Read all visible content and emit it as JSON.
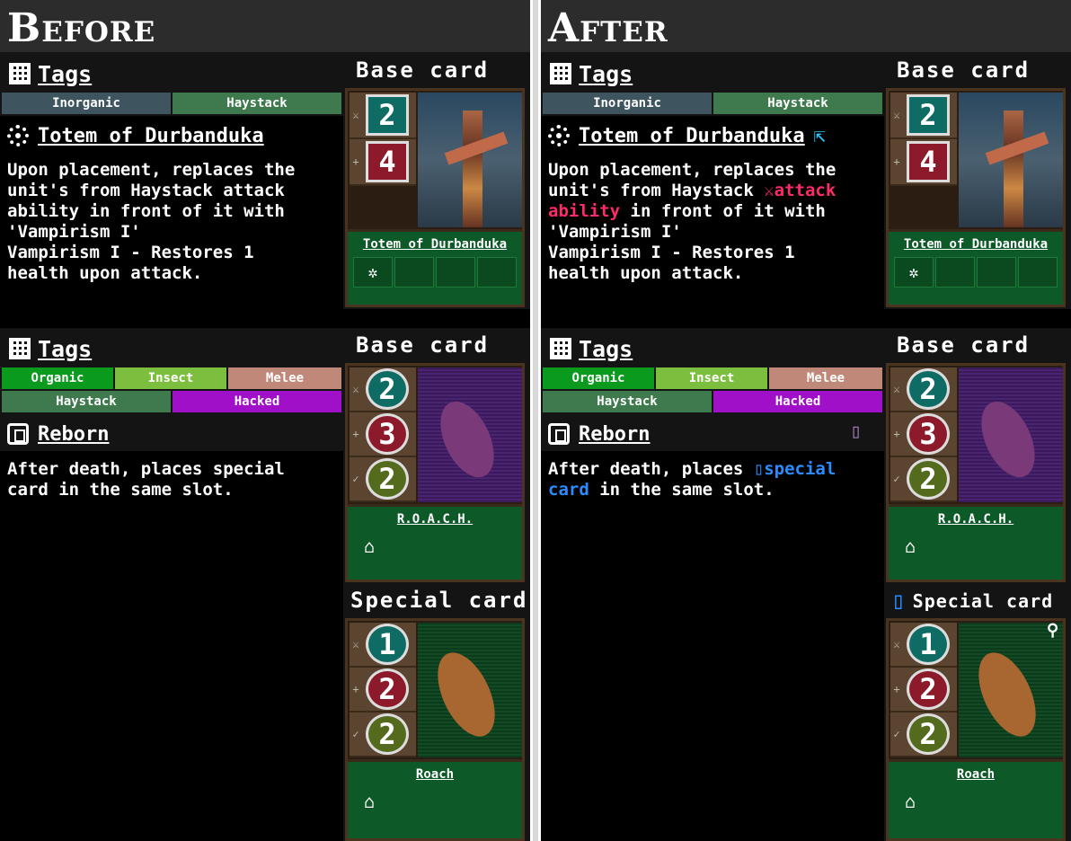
{
  "before": {
    "title": "Before",
    "panel1": {
      "tags_label": "Tags",
      "base_card_label": "Base card",
      "tags": [
        "Inorganic",
        "Haystack"
      ],
      "ability_name": "Totem of Durbanduka",
      "description": [
        "Upon placement, replaces the",
        "unit's from Haystack attack",
        "ability in front of it with",
        "'Vampirism I'",
        "Vampirism I - Restores 1",
        "health upon attack."
      ],
      "card": {
        "attack": "2",
        "health": "4",
        "name": "Totem of Durbanduka"
      }
    },
    "panel2": {
      "tags_label": "Tags",
      "base_card_label": "Base card",
      "tags_row1": [
        "Organic",
        "Insect",
        "Melee"
      ],
      "tags_row2": [
        "Haystack",
        "Hacked"
      ],
      "ability_name": "Reborn",
      "description": [
        "After death, places special",
        "card in the same slot."
      ],
      "card": {
        "attack": "2",
        "health": "3",
        "armor": "2",
        "name": "R.O.A.C.H."
      },
      "special_card_label": "Special card",
      "special_card": {
        "attack": "1",
        "health": "2",
        "armor": "2",
        "name": "Roach"
      }
    }
  },
  "after": {
    "title": "After",
    "panel1": {
      "tags_label": "Tags",
      "base_card_label": "Base card",
      "tags": [
        "Inorganic",
        "Haystack"
      ],
      "ability_name": "Totem of Durbanduka",
      "description": {
        "l1": "Upon placement, replaces the",
        "l2a": "unit's from Haystack ",
        "l2b": "attack",
        "l3a": "ability",
        "l3b": " in front of it with",
        "l4": "'Vampirism I'",
        "l5": "Vampirism I - Restores 1",
        "l6": "health upon attack."
      },
      "card": {
        "attack": "2",
        "health": "4",
        "name": "Totem of Durbanduka"
      }
    },
    "panel2": {
      "tags_label": "Tags",
      "base_card_label": "Base card",
      "tags_row1": [
        "Organic",
        "Insect",
        "Melee"
      ],
      "tags_row2": [
        "Haystack",
        "Hacked"
      ],
      "ability_name": "Reborn",
      "description": {
        "l1a": "After death, places ",
        "l1b": "special",
        "l2a": "card",
        "l2b": " in the same slot."
      },
      "card": {
        "attack": "2",
        "health": "3",
        "armor": "2",
        "name": "R.O.A.C.H."
      },
      "special_card_label": "Special card",
      "special_card": {
        "attack": "1",
        "health": "2",
        "armor": "2",
        "name": "Roach"
      }
    }
  },
  "colors": {
    "inorganic": "#3e545e",
    "haystack": "#3f7a4e",
    "organic": "#0a9a1e",
    "insect": "#7cbf3e",
    "melee": "#c08878",
    "hacked": "#a010c8",
    "highlight_red": "#ff2a6a",
    "highlight_blue": "#2a8cff"
  }
}
